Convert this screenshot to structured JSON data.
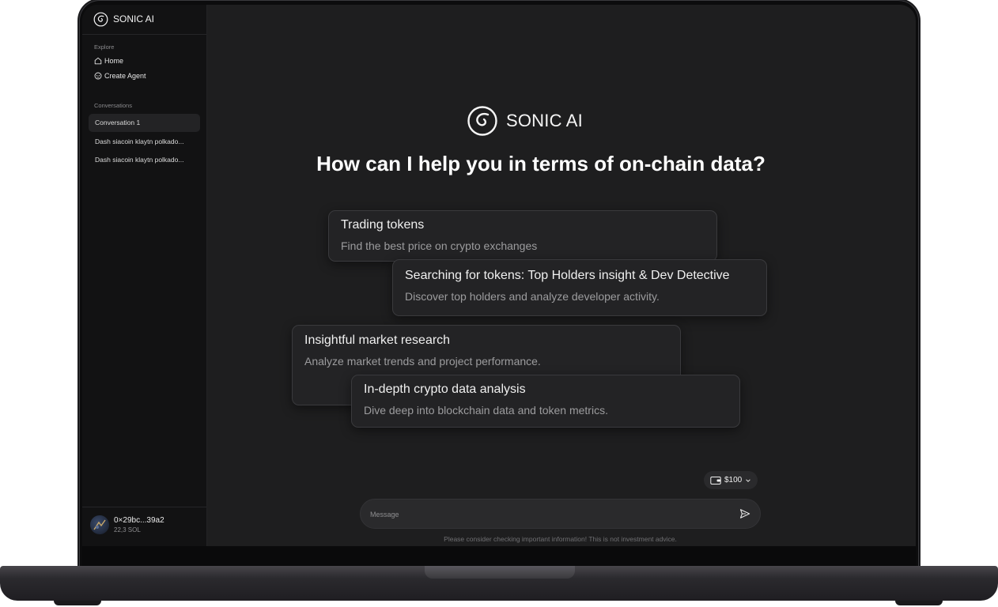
{
  "app": {
    "brand": "SONIC AI"
  },
  "sidebar": {
    "explore_label": "Explore",
    "nav": [
      {
        "label": "Home",
        "icon": "home-icon"
      },
      {
        "label": "Create Agent",
        "icon": "agent-icon"
      }
    ],
    "conversations_label": "Conversations",
    "conversations": [
      {
        "label": "Conversation 1",
        "active": true
      },
      {
        "label": "Dash siacoin klaytn polkado...",
        "active": false
      },
      {
        "label": "Dash siacoin klaytn polkado...",
        "active": false
      }
    ],
    "user": {
      "address": "0×29bc...39a2",
      "balance": "22,3 SOL"
    }
  },
  "main": {
    "brand": "SONIC AI",
    "headline": "How can I help you in terms of on-chain data?",
    "cards": [
      {
        "title": "Trading tokens",
        "desc": "Find the best price on crypto exchanges"
      },
      {
        "title": "Searching for tokens: Top Holders insight & Dev Detective",
        "desc": "Discover top holders and analyze developer activity."
      },
      {
        "title": "Insightful market research",
        "desc": "Analyze market trends and project performance."
      },
      {
        "title": "In-depth crypto data analysis",
        "desc": "Dive deep into blockchain data and token metrics."
      }
    ],
    "balance_chip": "$100",
    "message_placeholder": "Message",
    "disclaimer": "Please consider checking important information! This is not investment advice."
  },
  "colors": {
    "background": "#1e1e1f",
    "sidebar": "#121213",
    "card": "#232325",
    "text": "#ffffff"
  }
}
